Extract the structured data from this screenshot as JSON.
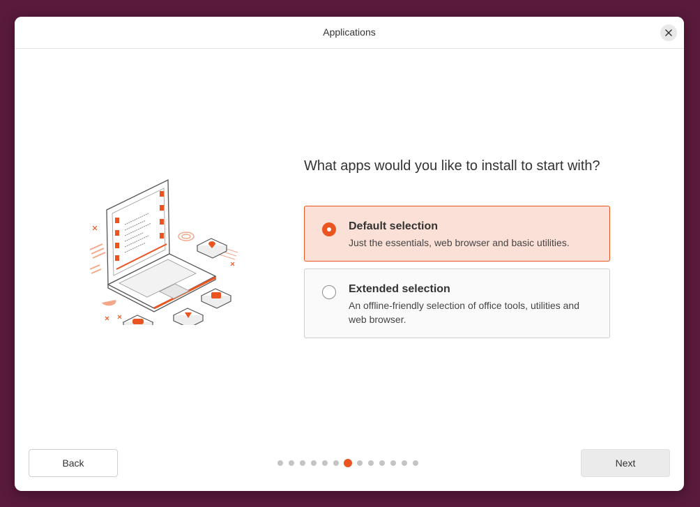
{
  "window": {
    "title": "Applications"
  },
  "question": "What apps would you like to install to start with?",
  "options": [
    {
      "title": "Default selection",
      "description": "Just the essentials, web browser and basic utilities.",
      "selected": true
    },
    {
      "title": "Extended selection",
      "description": "An offline-friendly selection of office tools, utilities and web browser.",
      "selected": false
    }
  ],
  "buttons": {
    "back": "Back",
    "next": "Next"
  },
  "pager": {
    "total": 13,
    "current": 7
  },
  "colors": {
    "accent": "#e95420",
    "desktop": "#5a1a3c",
    "selected_bg": "#fbe0d7"
  },
  "icons": [
    "close-icon",
    "laptop-illustration"
  ]
}
